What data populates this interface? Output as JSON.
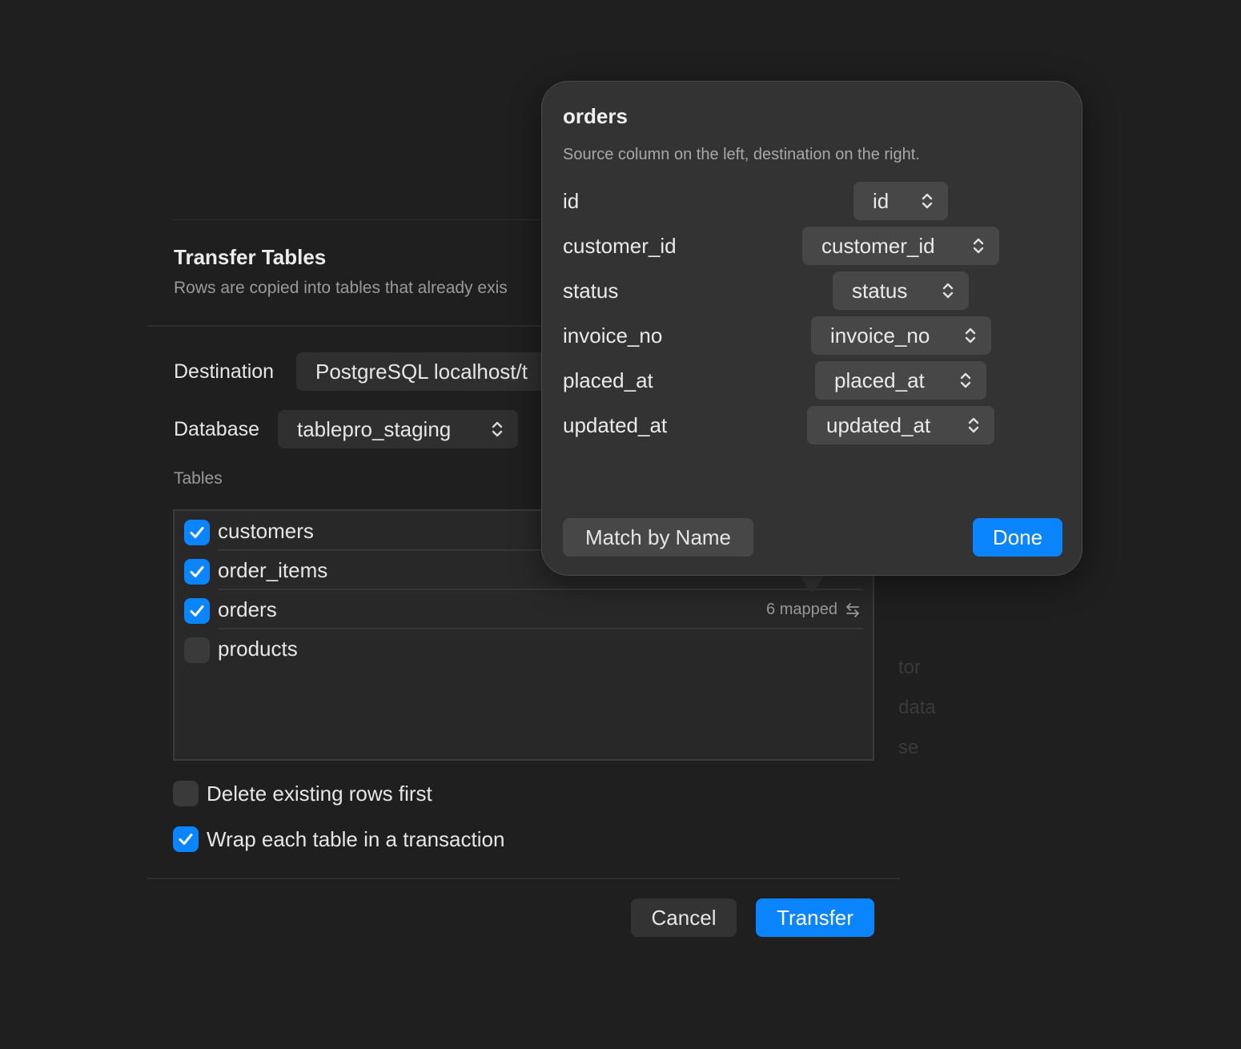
{
  "dialog": {
    "title": "Transfer Tables",
    "subtitle": "Rows are copied into tables that already exis",
    "destination_label": "Destination",
    "destination_value": "PostgreSQL localhost/t",
    "database_label": "Database",
    "database_value": "tablepro_staging",
    "tables_label": "Tables",
    "tables": [
      {
        "name": "customers",
        "checked": true,
        "mapped": ""
      },
      {
        "name": "order_items",
        "checked": true,
        "mapped": ""
      },
      {
        "name": "orders",
        "checked": true,
        "mapped": "6 mapped"
      },
      {
        "name": "products",
        "checked": false,
        "mapped": ""
      }
    ],
    "options": [
      {
        "label": "Delete existing rows first",
        "checked": false
      },
      {
        "label": "Wrap each table in a transaction",
        "checked": true
      }
    ],
    "cancel_label": "Cancel",
    "transfer_label": "Transfer",
    "obscured_text": [
      "tor",
      "data",
      "se"
    ]
  },
  "popover": {
    "title": "orders",
    "subtitle": "Source column on the left, destination on the right.",
    "mappings": [
      {
        "source": "id",
        "destination": "id"
      },
      {
        "source": "customer_id",
        "destination": "customer_id"
      },
      {
        "source": "status",
        "destination": "status"
      },
      {
        "source": "invoice_no",
        "destination": "invoice_no"
      },
      {
        "source": "placed_at",
        "destination": "placed_at"
      },
      {
        "source": "updated_at",
        "destination": "updated_at"
      }
    ],
    "match_label": "Match by Name",
    "done_label": "Done"
  },
  "colors": {
    "accent": "#0a84ff",
    "background": "#1f1f1f",
    "popover": "#343434"
  }
}
